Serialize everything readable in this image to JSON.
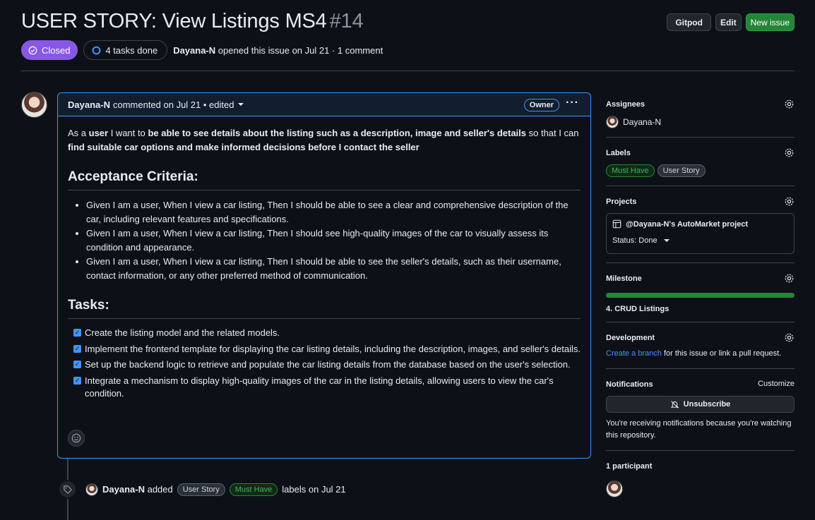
{
  "header": {
    "title": "USER STORY: View Listings MS4",
    "number": "#14",
    "buttons": {
      "gitpod": "Gitpod",
      "edit": "Edit",
      "new_issue": "New issue"
    }
  },
  "meta": {
    "state": "Closed",
    "tasks": "4 tasks done",
    "author": "Dayana-N",
    "opened_text": "opened this issue on Jul 21 · 1 comment"
  },
  "comment": {
    "author": "Dayana-N",
    "when": "commented on Jul 21 • edited",
    "badge": "Owner",
    "intro": {
      "p1": "As a ",
      "b1": "user",
      "p2": " I want to ",
      "b2": "be able to see details about the listing such as a description, image and seller's details",
      "p3": " so that I can ",
      "b3": "find suitable car options and make informed decisions before I contact the seller"
    },
    "acceptance_heading": "Acceptance Criteria:",
    "criteria": [
      "Given I am a user, When I view a car listing, Then I should be able to see a clear and comprehensive description of the car, including relevant features and specifications.",
      "Given I am a user, When I view a car listing, Then I should see high-quality images of the car to visually assess its condition and appearance.",
      "Given I am a user, When I view a car listing, Then I should be able to see the seller's details, such as their username, contact information, or any other preferred method of communication."
    ],
    "tasks_heading": "Tasks:",
    "tasks": [
      "Create the listing model and the related models.",
      "Implement the frontend template for displaying the car listing details, including the description, images, and seller's details.",
      "Set up the backend logic to retrieve and populate the car listing details from the database based on the user's selection.",
      "Integrate a mechanism to display high-quality images of the car in the listing details, allowing users to view the car's condition."
    ]
  },
  "event": {
    "author": "Dayana-N",
    "added": "added",
    "label1": "User Story",
    "label2": "Must Have",
    "suffix": "labels on Jul 21"
  },
  "sidebar": {
    "assignees_title": "Assignees",
    "assignee": "Dayana-N",
    "labels_title": "Labels",
    "labels": [
      "Must Have",
      "User Story"
    ],
    "projects_title": "Projects",
    "project_name": "@Dayana-N's AutoMarket project",
    "project_status": "Status: Done",
    "milestone_title": "Milestone",
    "milestone_progress": 1.0,
    "milestone_name": "4. CRUD Listings",
    "development_title": "Development",
    "dev_link": "Create a branch",
    "dev_text": "for this issue or link a pull request.",
    "notifications_title": "Notifications",
    "customize": "Customize",
    "unsubscribe": "Unsubscribe",
    "notif_text": "You're receiving notifications because you're watching this repository.",
    "participants": "1 participant"
  },
  "colors": {
    "closed": "#8957e5",
    "accent": "#4493f8",
    "green": "#238636"
  }
}
